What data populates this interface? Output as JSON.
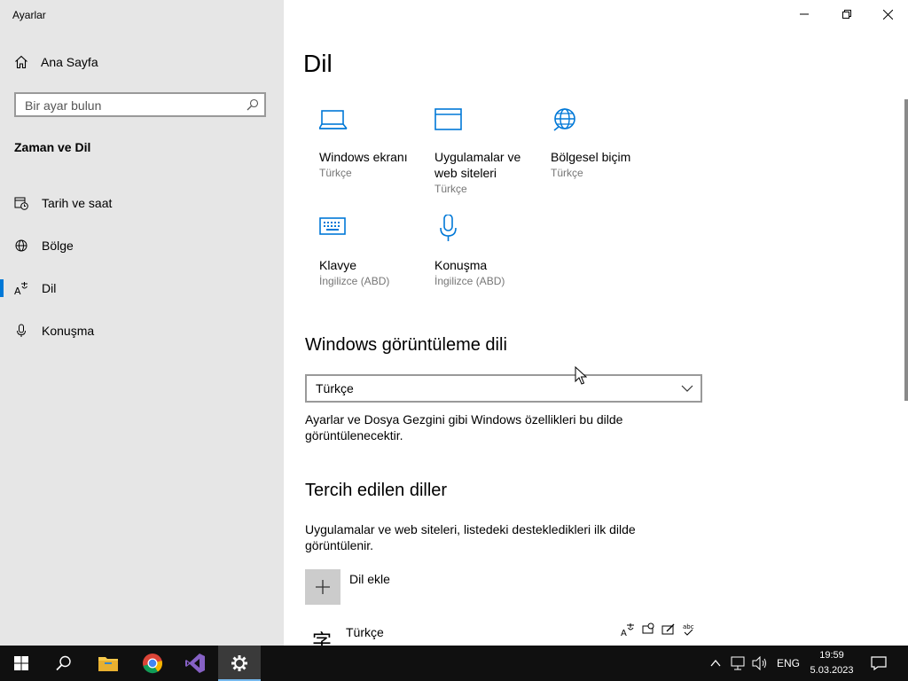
{
  "app": {
    "title": "Ayarlar"
  },
  "sidebar": {
    "home_label": "Ana Sayfa",
    "search_placeholder": "Bir ayar bulun",
    "group_title": "Zaman ve Dil",
    "items": [
      {
        "label": "Tarih ve saat",
        "icon": "calendar-clock-icon",
        "active": false
      },
      {
        "label": "Bölge",
        "icon": "globe-icon",
        "active": false
      },
      {
        "label": "Dil",
        "icon": "language-icon",
        "active": true
      },
      {
        "label": "Konuşma",
        "icon": "microphone-icon",
        "active": false
      }
    ]
  },
  "main": {
    "title": "Dil",
    "tiles": [
      {
        "label": "Windows ekranı",
        "sub": "Türkçe",
        "icon": "laptop-icon"
      },
      {
        "label": "Uygulamalar ve web siteleri",
        "sub": "Türkçe",
        "icon": "app-window-icon"
      },
      {
        "label": "Bölgesel biçim",
        "sub": "Türkçe",
        "icon": "globe-icon"
      },
      {
        "label": "Klavye",
        "sub": "İngilizce (ABD)",
        "icon": "keyboard-icon"
      },
      {
        "label": "Konuşma",
        "sub": "İngilizce (ABD)",
        "icon": "microphone-icon"
      }
    ],
    "display_language": {
      "heading": "Windows görüntüleme dili",
      "selected": "Türkçe",
      "description": "Ayarlar ve Dosya Gezgini gibi Windows özellikleri bu dilde görüntülenecektir."
    },
    "preferred": {
      "heading": "Tercih edilen diller",
      "description": "Uygulamalar ve web siteleri, listedeki destekledikleri ilk dilde görüntülenir.",
      "add_label": "Dil ekle",
      "languages": [
        {
          "name": "Türkçe",
          "glyph": "字"
        }
      ]
    }
  },
  "taskbar": {
    "tray_language": "ENG",
    "time": "19:59",
    "date": "5.03.2023"
  },
  "colors": {
    "accent": "#0078d7",
    "sidebar_bg": "#e6e6e6",
    "taskbar_bg": "#101010"
  }
}
